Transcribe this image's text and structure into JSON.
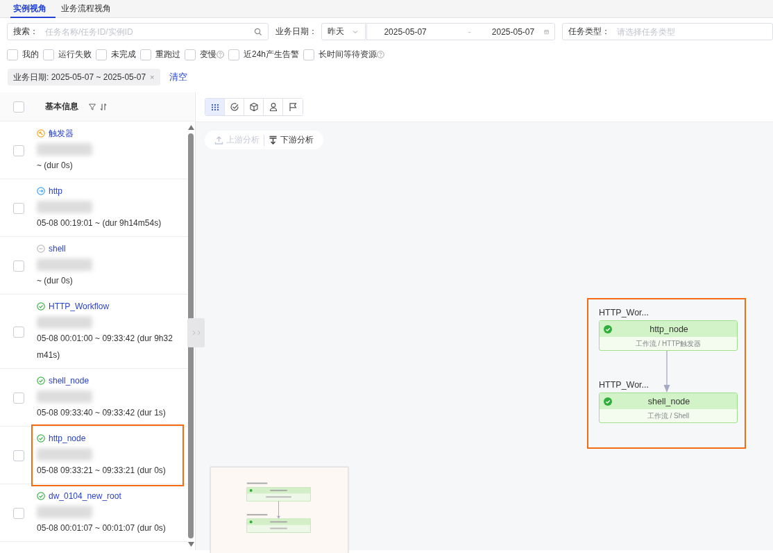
{
  "tabs": [
    {
      "label": "实例视角",
      "selected": true
    },
    {
      "label": "业务流程视角",
      "selected": false
    }
  ],
  "filters": {
    "search": {
      "label": "搜索：",
      "placeholder": "任务名称/任务ID/实例ID"
    },
    "date": {
      "label": "业务日期：",
      "preset": "昨天",
      "start": "2025-05-07",
      "separator": "-",
      "end": "2025-05-07"
    },
    "task_type": {
      "label": "任务类型：",
      "placeholder": "请选择任务类型"
    }
  },
  "quick_filters": [
    {
      "label": "我的",
      "checked": false,
      "help": false
    },
    {
      "label": "运行失败",
      "checked": false,
      "help": false
    },
    {
      "label": "未完成",
      "checked": false,
      "help": false
    },
    {
      "label": "重跑过",
      "checked": false,
      "help": false
    },
    {
      "label": "变慢",
      "checked": false,
      "help": true
    },
    {
      "label": "近24h产生告警",
      "checked": false,
      "help": false
    },
    {
      "label": "长时间等待资源",
      "checked": false,
      "help": true
    }
  ],
  "active_filters": [
    {
      "label": "业务日期: 2025-05-07 ~ 2025-05-07",
      "close": "×"
    }
  ],
  "clear": "清空",
  "list": {
    "header": {
      "title": "基本信息",
      "checked": false
    },
    "rows": [
      {
        "name": "触发器",
        "kind": "trigger",
        "time": "~ (dur 0s)",
        "checked": false,
        "highlighted": false
      },
      {
        "name": "http",
        "kind": "http",
        "time": "05-08 00:19:01 ~ (dur 9h14m54s)",
        "checked": false,
        "highlighted": false
      },
      {
        "name": "shell",
        "kind": "skipped",
        "time": "~ (dur 0s)",
        "checked": false,
        "highlighted": false
      },
      {
        "name": "HTTP_Workflow",
        "kind": "success",
        "time": "05-08 00:01:00 ~ 09:33:42 (dur 9h32m41s)",
        "checked": false,
        "highlighted": false
      },
      {
        "name": "shell_node",
        "kind": "success",
        "time": "05-08 09:33:40 ~ 09:33:42 (dur 1s)",
        "checked": false,
        "highlighted": false
      },
      {
        "name": "http_node",
        "kind": "success",
        "time": "05-08 09:33:21 ~ 09:33:21 (dur 0s)",
        "checked": false,
        "highlighted": true
      },
      {
        "name": "dw_0104_new_root",
        "kind": "success",
        "time": "05-08 00:01:07 ~ 00:01:07 (dur 0s)",
        "checked": false,
        "highlighted": false
      }
    ]
  },
  "graph": {
    "views": [
      {
        "selected": true
      },
      {
        "selected": false
      },
      {
        "selected": false
      },
      {
        "selected": false
      },
      {
        "selected": false
      }
    ],
    "analysis": [
      {
        "kind": "upstream",
        "label": "上游分析",
        "disabled": true
      },
      {
        "kind": "downstream",
        "label": "下游分析",
        "disabled": false
      }
    ],
    "highlighted": true,
    "nodes": [
      {
        "group": "HTTP_Wor...",
        "name": "http_node",
        "type": "工作流 / HTTP触发器"
      },
      {
        "group": "HTTP_Wor...",
        "name": "shell_node",
        "type": "工作流 / Shell"
      }
    ]
  }
}
